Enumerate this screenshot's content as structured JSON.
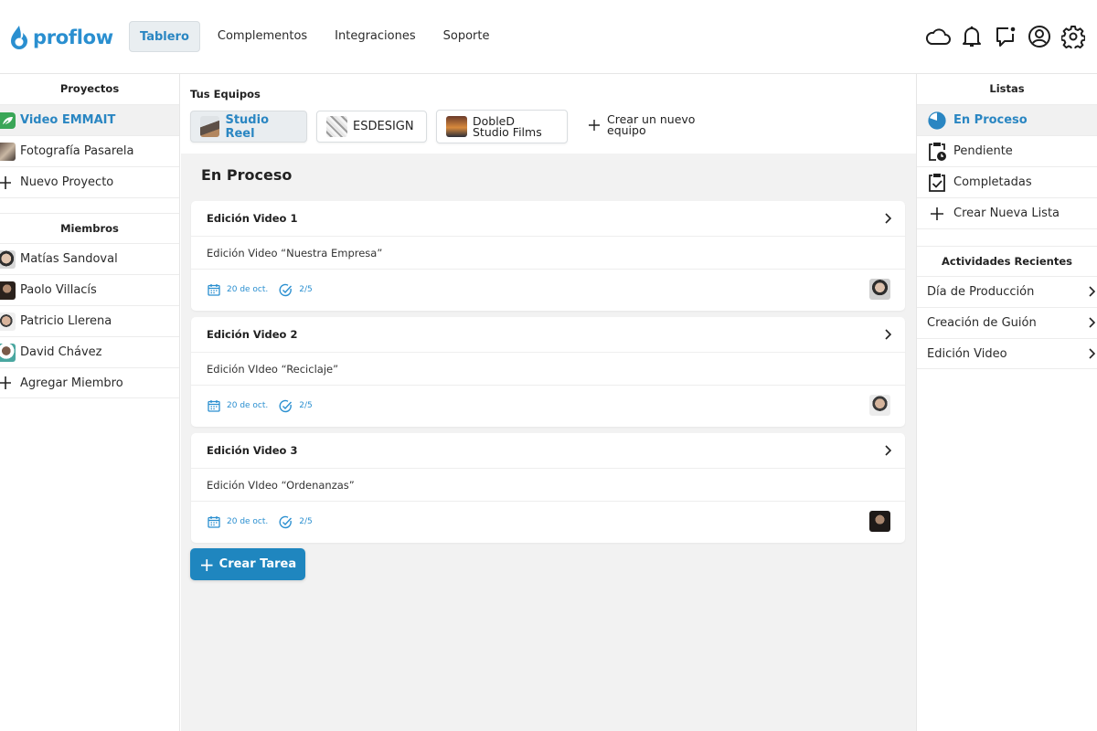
{
  "app": {
    "brand": "proflow",
    "accent_color": "#2a86c2",
    "button_color": "#1f86bf"
  },
  "nav": {
    "items": [
      "Tablero",
      "Complementos",
      "Integraciones",
      "Soporte"
    ],
    "active": "Tablero"
  },
  "header_icons": [
    "cloud-icon",
    "bell-icon",
    "chat-notification-icon",
    "account-icon",
    "settings-icon"
  ],
  "left_sidebar": {
    "projects_title": "Proyectos",
    "projects": [
      {
        "label": "Video EMMAIT",
        "icon": "leaf-icon",
        "active": true
      },
      {
        "label": "Fotografía Pasarela",
        "icon": "project-thumbnail"
      }
    ],
    "new_project_label": "Nuevo Proyecto",
    "members_title": "Miembros",
    "members": [
      {
        "name": "Matías Sandoval"
      },
      {
        "name": "Paolo Villacís"
      },
      {
        "name": "Patricio Llerena"
      },
      {
        "name": "David Chávez"
      }
    ],
    "add_member_label": "Agregar Miembro"
  },
  "teams": {
    "title": "Tus Equipos",
    "items": [
      {
        "name": "Studio Reel",
        "active": true
      },
      {
        "name": "ESDESIGN",
        "active": false
      },
      {
        "name_line1": "DobleD",
        "name_line2": "Studio Films",
        "active": false
      }
    ],
    "create_line1": "Crear un nuevo",
    "create_line2": "equipo"
  },
  "main": {
    "heading": "En Proceso",
    "tasks": [
      {
        "title": "Edición Video 1",
        "description": "Edición Video “Nuestra Empresa”",
        "date": "20 de oct.",
        "progress": "2/5"
      },
      {
        "title": "Edición Video 2",
        "description": "Edición VIdeo “Reciclaje”",
        "date": "20 de oct.",
        "progress": "2/5"
      },
      {
        "title": "Edición Video 3",
        "description": "Edición VIdeo “Ordenanzas”",
        "date": "20 de oct.",
        "progress": "2/5"
      }
    ],
    "create_task_label": "Crear Tarea"
  },
  "right_sidebar": {
    "lists_title": "Listas",
    "lists": [
      {
        "label": "En Proceso",
        "icon": "pie-progress-icon",
        "active": true
      },
      {
        "label": "Pendiente",
        "icon": "clipboard-clock-icon"
      },
      {
        "label": "Completadas",
        "icon": "clipboard-check-icon"
      },
      {
        "label": "Crear Nueva Lista",
        "icon": "plus-icon"
      }
    ],
    "activities_title": "Actividades Recientes",
    "activities": [
      {
        "label": "Día de Producción"
      },
      {
        "label": "Creación de Guión"
      },
      {
        "label": "Edición Video"
      }
    ]
  }
}
